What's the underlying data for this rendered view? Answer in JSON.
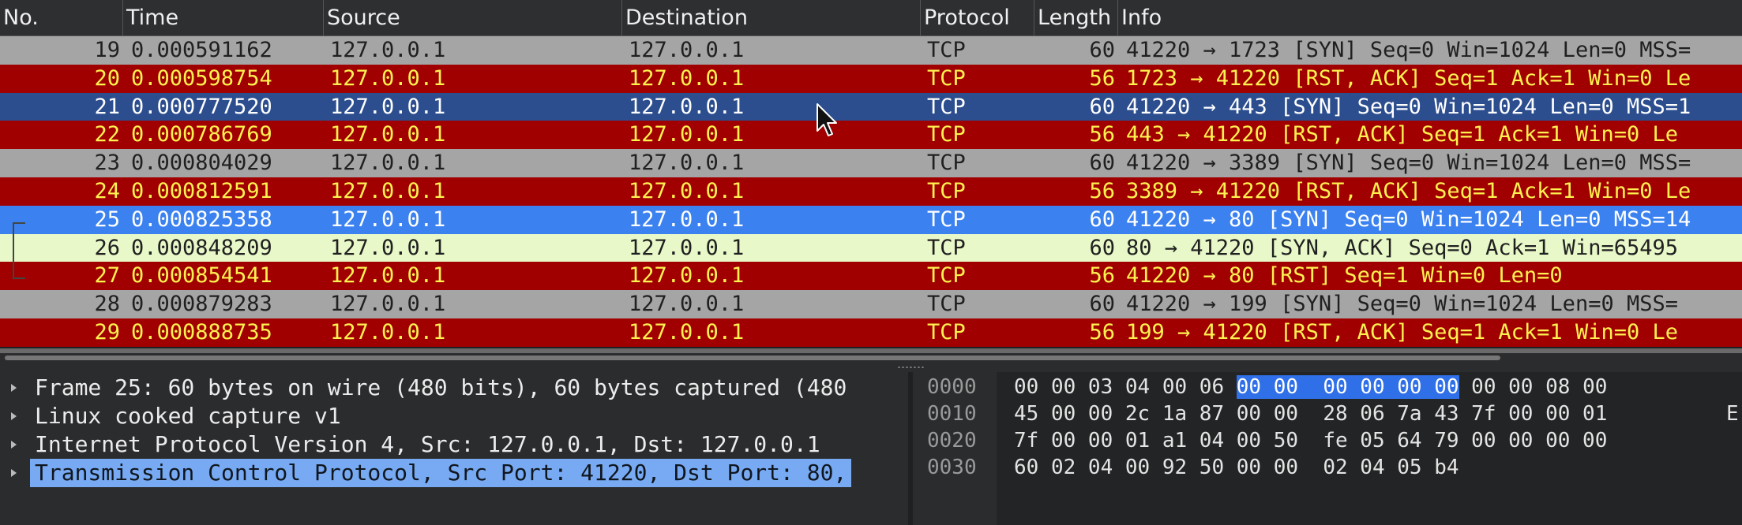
{
  "columns": {
    "no": "No.",
    "time": "Time",
    "source": "Source",
    "destination": "Destination",
    "protocol": "Protocol",
    "length": "Length",
    "info": "Info"
  },
  "packets": [
    {
      "no": "19",
      "time": "0.000591162",
      "src": "127.0.0.1",
      "dst": "127.0.0.1",
      "proto": "TCP",
      "len": "60",
      "info": "41220 → 1723 [SYN] Seq=0 Win=1024 Len=0 MSS=",
      "style": "gray"
    },
    {
      "no": "20",
      "time": "0.000598754",
      "src": "127.0.0.1",
      "dst": "127.0.0.1",
      "proto": "TCP",
      "len": "56",
      "info": "1723 → 41220 [RST, ACK] Seq=1 Ack=1 Win=0 Le",
      "style": "red"
    },
    {
      "no": "21",
      "time": "0.000777520",
      "src": "127.0.0.1",
      "dst": "127.0.0.1",
      "proto": "TCP",
      "len": "60",
      "info": "41220 → 443 [SYN] Seq=0 Win=1024 Len=0 MSS=1",
      "style": "blue-sel"
    },
    {
      "no": "22",
      "time": "0.000786769",
      "src": "127.0.0.1",
      "dst": "127.0.0.1",
      "proto": "TCP",
      "len": "56",
      "info": "443 → 41220 [RST, ACK] Seq=1 Ack=1 Win=0 Le",
      "style": "red"
    },
    {
      "no": "23",
      "time": "0.000804029",
      "src": "127.0.0.1",
      "dst": "127.0.0.1",
      "proto": "TCP",
      "len": "60",
      "info": "41220 → 3389 [SYN] Seq=0 Win=1024 Len=0 MSS=",
      "style": "gray"
    },
    {
      "no": "24",
      "time": "0.000812591",
      "src": "127.0.0.1",
      "dst": "127.0.0.1",
      "proto": "TCP",
      "len": "56",
      "info": "3389 → 41220 [RST, ACK] Seq=1 Ack=1 Win=0 Le",
      "style": "red"
    },
    {
      "no": "25",
      "time": "0.000825358",
      "src": "127.0.0.1",
      "dst": "127.0.0.1",
      "proto": "TCP",
      "len": "60",
      "info": "41220 → 80 [SYN] Seq=0 Win=1024 Len=0 MSS=14",
      "style": "blue-hl"
    },
    {
      "no": "26",
      "time": "0.000848209",
      "src": "127.0.0.1",
      "dst": "127.0.0.1",
      "proto": "TCP",
      "len": "60",
      "info": "80 → 41220 [SYN, ACK] Seq=0 Ack=1 Win=65495",
      "style": "green"
    },
    {
      "no": "27",
      "time": "0.000854541",
      "src": "127.0.0.1",
      "dst": "127.0.0.1",
      "proto": "TCP",
      "len": "56",
      "info": "41220 → 80 [RST] Seq=1 Win=0 Len=0",
      "style": "red"
    },
    {
      "no": "28",
      "time": "0.000879283",
      "src": "127.0.0.1",
      "dst": "127.0.0.1",
      "proto": "TCP",
      "len": "60",
      "info": "41220 → 199 [SYN] Seq=0 Win=1024 Len=0 MSS=",
      "style": "gray"
    },
    {
      "no": "29",
      "time": "0.000888735",
      "src": "127.0.0.1",
      "dst": "127.0.0.1",
      "proto": "TCP",
      "len": "56",
      "info": "199 → 41220 [RST, ACK] Seq=1 Ack=1 Win=0 Le",
      "style": "red"
    }
  ],
  "details": [
    {
      "text": "Frame 25: 60 bytes on wire (480 bits), 60 bytes captured (480",
      "selected": false
    },
    {
      "text": "Linux cooked capture v1",
      "selected": false
    },
    {
      "text": "Internet Protocol Version 4, Src: 127.0.0.1, Dst: 127.0.0.1",
      "selected": false
    },
    {
      "text": "Transmission Control Protocol, Src Port: 41220, Dst Port: 80,",
      "selected": true
    }
  ],
  "hex": [
    {
      "offset": "0000",
      "pre": "00 00 03 04 00 06 ",
      "sel": "00 00  00 00 00 00",
      "post": " 00 00 08 00",
      "ascii": ""
    },
    {
      "offset": "0010",
      "pre": "45 00 00 2c 1a 87 00 00  28 06 7a 43 7f 00 00 01",
      "sel": "",
      "post": "",
      "ascii": "E"
    },
    {
      "offset": "0020",
      "pre": "7f 00 00 01 a1 04 00 50  fe 05 64 79 00 00 00 00",
      "sel": "",
      "post": "",
      "ascii": ""
    },
    {
      "offset": "0030",
      "pre": "60 02 04 00 92 50 00 00  02 04 05 b4",
      "sel": "",
      "post": "",
      "ascii": ""
    }
  ],
  "colors": {
    "gray_row": "#a5a5a5",
    "red_row": "#a00000",
    "red_text": "#fff250",
    "selected_row": "#2c4e8e",
    "highlight_row": "#3b82f0",
    "green_row": "#e8f8c8",
    "detail_selection": "#77aaf2",
    "hex_selection": "#2f6fe8"
  },
  "icons": {
    "expand": "expand-triangle-icon",
    "cursor": "mouse-pointer-icon"
  }
}
